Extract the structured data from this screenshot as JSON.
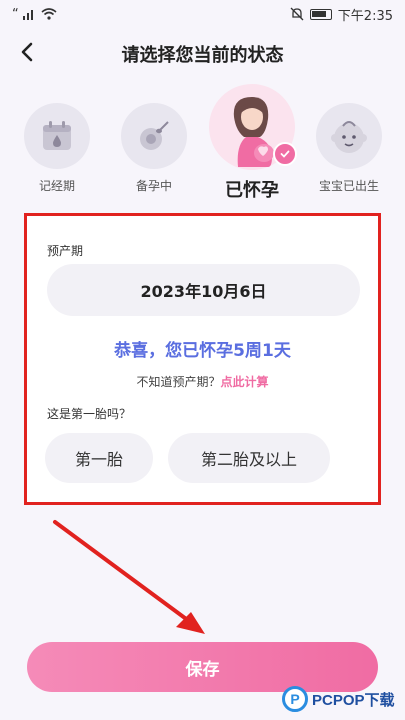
{
  "status_bar": {
    "carrier_symbol": "“",
    "signal": "ıll",
    "time": "下午2:35"
  },
  "header": {
    "title": "请选择您当前的状态"
  },
  "states": [
    {
      "label": "记经期",
      "icon": "calendar-drop-icon",
      "selected": false
    },
    {
      "label": "备孕中",
      "icon": "egg-sperm-icon",
      "selected": false
    },
    {
      "label": "已怀孕",
      "icon": "pregnant-woman-icon",
      "selected": true
    },
    {
      "label": "宝宝已出生",
      "icon": "baby-face-icon",
      "selected": false
    }
  ],
  "form": {
    "due_date_label": "预产期",
    "due_date_value": "2023年10月6日",
    "congrats": "恭喜，您已怀孕5周1天",
    "unknown_prompt": "不知道预产期？",
    "calc_link": "点此计算",
    "first_child_question": "这是第一胎吗？",
    "options": [
      "第一胎",
      "第二胎及以上"
    ]
  },
  "save_label": "保存",
  "watermark": {
    "logo_letter": "P",
    "text": "PCPOP下载"
  },
  "colors": {
    "accent_pink": "#f06ca3",
    "congrats_blue": "#5a6ee0",
    "highlight_red": "#e1221f"
  }
}
